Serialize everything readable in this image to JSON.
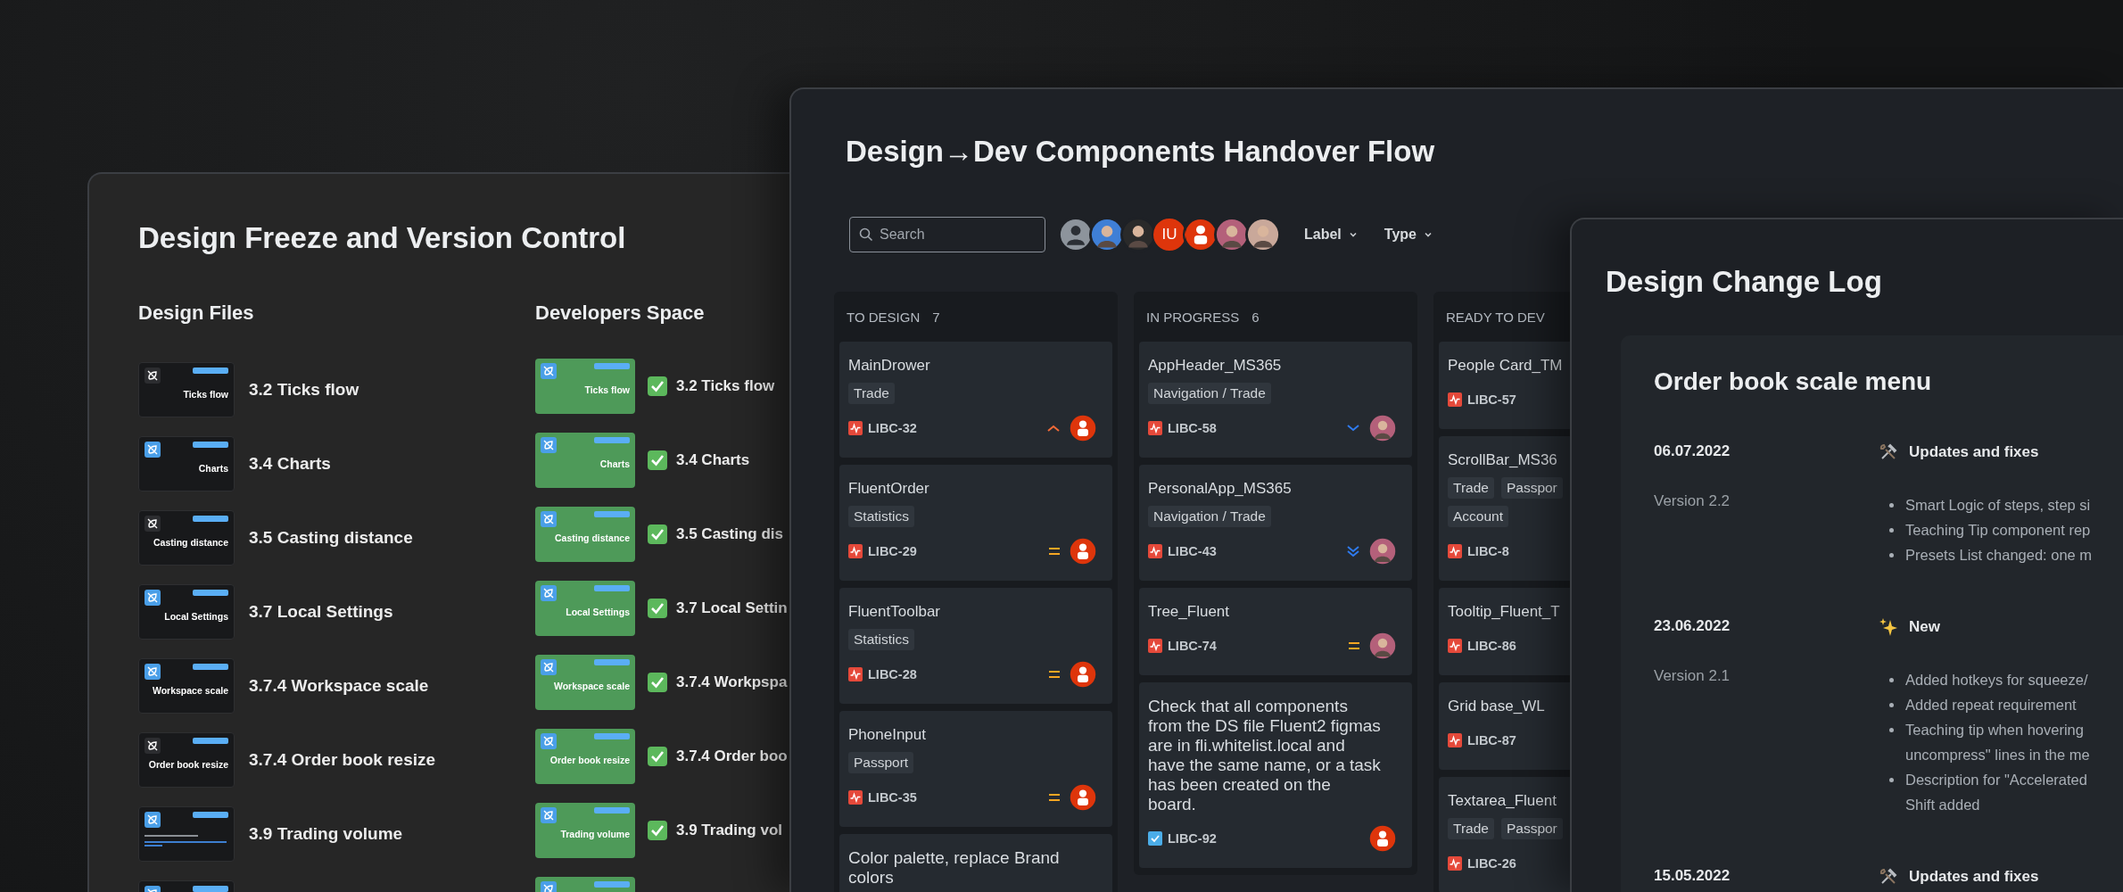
{
  "design_freeze": {
    "title": "Design Freeze and Version Control",
    "design_files": {
      "heading": "Design Files",
      "items": [
        {
          "kind": "label",
          "thumb_label": "Ticks flow",
          "title": "3.2 Ticks flow",
          "icon_highlighted": false
        },
        {
          "kind": "label",
          "thumb_label": "Charts",
          "title": "3.4 Charts",
          "icon_highlighted": true
        },
        {
          "kind": "label",
          "thumb_label": "Casting distance",
          "title": "3.5 Casting distance",
          "icon_highlighted": false
        },
        {
          "kind": "label",
          "thumb_label": "Local Settings",
          "title": "3.7 Local Settings",
          "icon_highlighted": true
        },
        {
          "kind": "label",
          "thumb_label": "Workspace scale",
          "title": "3.7.4 Workspace scale",
          "icon_highlighted": true
        },
        {
          "kind": "label",
          "thumb_label": "Order book resize",
          "title": "3.7.4 Order book resize",
          "icon_highlighted": false
        },
        {
          "kind": "document",
          "title": "3.9 Trading volume",
          "icon_highlighted": true
        },
        {
          "kind": "blank",
          "icon_highlighted": true
        }
      ]
    },
    "developers_space": {
      "heading": "Developers Space",
      "items": [
        {
          "kind": "label",
          "thumb_label": "Ticks flow",
          "title": "3.2 Ticks flow",
          "done": true
        },
        {
          "kind": "label",
          "thumb_label": "Charts",
          "title": "3.4 Charts",
          "done": true
        },
        {
          "kind": "label",
          "thumb_label": "Casting distance",
          "title": "3.5 Casting dis",
          "done": true
        },
        {
          "kind": "label",
          "thumb_label": "Local Settings",
          "title": "3.7 Local Settin",
          "done": true
        },
        {
          "kind": "label",
          "thumb_label": "Workspace scale",
          "title": "3.7.4 Workpspa",
          "done": true
        },
        {
          "kind": "label",
          "thumb_label": "Order book resize",
          "title": "3.7.4 Order boo",
          "done": true
        },
        {
          "kind": "label",
          "thumb_label": "Trading volume",
          "title": "3.9 Trading vol",
          "done": true
        },
        {
          "kind": "blank",
          "done": false
        }
      ]
    }
  },
  "handover": {
    "title": "Design→Dev Components Handover Flow",
    "search": {
      "placeholder": "Search"
    },
    "avatars": [
      {
        "kind": "default"
      },
      {
        "kind": "photo",
        "color": "#3f7fd6"
      },
      {
        "kind": "photo",
        "color": "#2a2a2a"
      },
      {
        "kind": "initials",
        "initials": "IU"
      },
      {
        "kind": "user"
      },
      {
        "kind": "photo",
        "color": "#b4607a"
      },
      {
        "kind": "photo",
        "color": "#c9a89a"
      }
    ],
    "filters": [
      {
        "label": "Label"
      },
      {
        "label": "Type"
      }
    ],
    "columns": [
      {
        "title": "TO DESIGN",
        "count": "7",
        "cards": [
          {
            "title": "MainDrower",
            "tags": [
              "Trade"
            ],
            "issue": {
              "kind": "bug"
            },
            "key": "LIBC-32",
            "priority": {
              "kind": "high"
            },
            "assignee": {
              "kind": "user"
            }
          },
          {
            "title": "FluentOrder",
            "tags": [
              "Statistics"
            ],
            "issue": {
              "kind": "bug"
            },
            "key": "LIBC-29",
            "priority": {
              "kind": "medium"
            },
            "assignee": {
              "kind": "user"
            }
          },
          {
            "title": "FluentToolbar",
            "tags": [
              "Statistics"
            ],
            "issue": {
              "kind": "bug"
            },
            "key": "LIBC-28",
            "priority": {
              "kind": "medium"
            },
            "assignee": {
              "kind": "user"
            }
          },
          {
            "title": "PhoneInput",
            "tags": [
              "Passport"
            ],
            "issue": {
              "kind": "bug"
            },
            "key": "LIBC-35",
            "priority": {
              "kind": "medium"
            },
            "assignee": {
              "kind": "user"
            }
          },
          {
            "title": "Color palette, replace Brand colors"
          }
        ]
      },
      {
        "title": "IN PROGRESS",
        "count": "6",
        "cards": [
          {
            "title": "AppHeader_MS365",
            "tags": [
              "Navigation / Trade"
            ],
            "issue": {
              "kind": "bug"
            },
            "key": "LIBC-58",
            "priority": {
              "kind": "low"
            },
            "assignee": {
              "kind": "photo"
            }
          },
          {
            "title": "PersonalApp_MS365",
            "tags": [
              "Navigation / Trade"
            ],
            "issue": {
              "kind": "bug"
            },
            "key": "LIBC-43",
            "priority": {
              "kind": "lowest"
            },
            "assignee": {
              "kind": "photo"
            }
          },
          {
            "title": "Tree_Fluent",
            "issue": {
              "kind": "bug"
            },
            "key": "LIBC-74",
            "priority": {
              "kind": "medium"
            },
            "assignee": {
              "kind": "photo"
            }
          },
          {
            "title": "Check that all components from the DS file Fluent2 figmas are in fli.whitelist.local and have the same name, or a task has been created on the board.",
            "issue": {
              "kind": "task"
            },
            "key": "LIBC-92",
            "assignee": {
              "kind": "user"
            }
          }
        ]
      },
      {
        "title": "READY TO DEV",
        "cards": [
          {
            "title": "People Card_TM",
            "issue": {
              "kind": "bug"
            },
            "key": "LIBC-57"
          },
          {
            "title": "ScrollBar_MS36",
            "tags": [
              "Trade",
              "Passpor",
              "Account"
            ],
            "issue": {
              "kind": "bug"
            },
            "key": "LIBC-8"
          },
          {
            "title": "Tooltip_Fluent_T",
            "issue": {
              "kind": "bug"
            },
            "key": "LIBC-86"
          },
          {
            "title": "Grid base_WL",
            "issue": {
              "kind": "bug"
            },
            "key": "LIBC-87"
          },
          {
            "title": "Textarea_Fluent",
            "tags": [
              "Trade",
              "Passpor"
            ],
            "issue": {
              "kind": "bug"
            },
            "key": "LIBC-26"
          }
        ]
      }
    ]
  },
  "change_log": {
    "title": "Design Change Log",
    "card_title": "Order book scale menu",
    "entries": [
      {
        "date": "06.07.2022",
        "kind": "updates",
        "heading": "Updates and fixes",
        "version": "Version 2.2",
        "notes": [
          {
            "lines": [
              "Smart Logic of steps, step si"
            ]
          },
          {
            "lines": [
              "Teaching Tip component rep"
            ]
          },
          {
            "lines": [
              "Presets List changed: one m"
            ]
          }
        ]
      },
      {
        "date": "23.06.2022",
        "kind": "new",
        "heading": "New",
        "version": "Version 2.1",
        "notes": [
          {
            "lines": [
              "Added hotkeys for squeeze/"
            ]
          },
          {
            "lines": [
              "Added repeat requirement"
            ]
          },
          {
            "lines": [
              "Teaching tip when hovering",
              "uncompress\" lines in the me"
            ]
          },
          {
            "lines": [
              "Description for \"Accelerated",
              "Shift added"
            ]
          }
        ]
      },
      {
        "date": "15.05.2022",
        "kind": "updates",
        "heading": "Updates and fixes"
      }
    ]
  }
}
